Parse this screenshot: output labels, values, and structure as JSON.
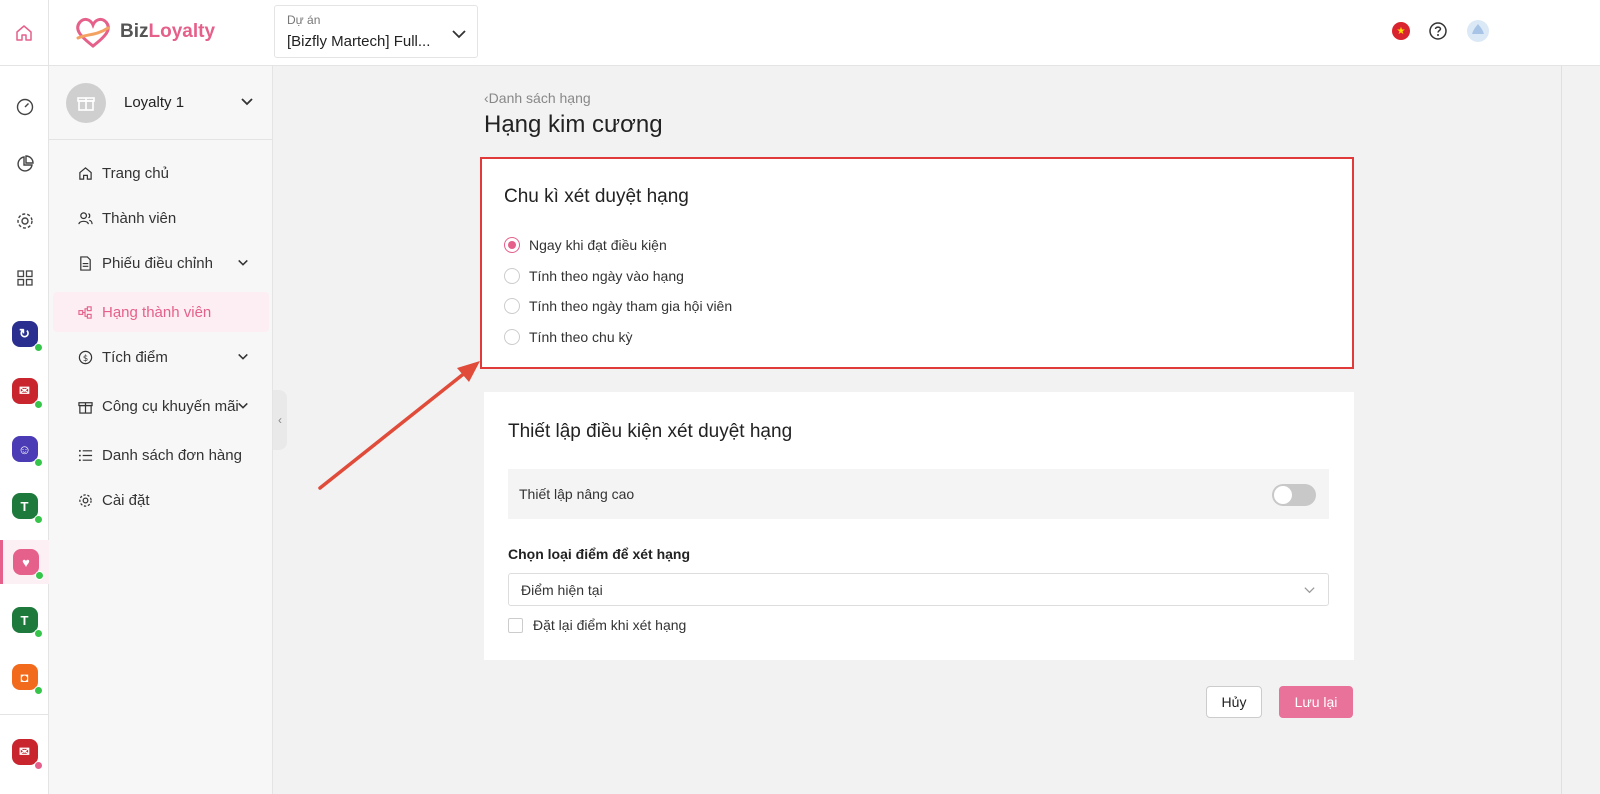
{
  "topbar": {
    "logo": {
      "part1": "Biz",
      "part2": "Loyalty"
    },
    "project": {
      "label": "Dự án",
      "value": "[Bizfly Martech] Full..."
    }
  },
  "colors": {
    "accent": "#e5608a",
    "highlight_border": "#e03a3a",
    "save_button": "#e9729a"
  },
  "sidebar": {
    "program": "Loyalty 1",
    "items": [
      {
        "label": "Trang chủ",
        "icon": "home-icon"
      },
      {
        "label": "Thành viên",
        "icon": "members-icon"
      },
      {
        "label": "Phiếu điều chỉnh",
        "icon": "document-icon"
      },
      {
        "label": "Hạng thành viên",
        "icon": "tier-icon"
      },
      {
        "label": "Tích điểm",
        "icon": "dollar-icon"
      },
      {
        "label": "Công cụ khuyến mãi",
        "icon": "gift-icon"
      },
      {
        "label": "Danh sách đơn hàng",
        "icon": "list-icon"
      },
      {
        "label": "Cài đặt",
        "icon": "gear-icon"
      }
    ]
  },
  "main": {
    "breadcrumb": "Danh sách hạng",
    "title": "Hạng kim cương",
    "cycle": {
      "title": "Chu kì xét duyệt hạng",
      "options": [
        "Ngay khi đạt điều kiện",
        "Tính theo ngày vào hạng",
        "Tính theo ngày tham gia hội viên",
        "Tính theo chu kỳ"
      ],
      "selected": 0
    },
    "conditions": {
      "title": "Thiết lập điều kiện xét duyệt hạng",
      "advanced_label": "Thiết lập nâng cao",
      "advanced_enabled": false,
      "points_label": "Chọn loại điểm để xét hạng",
      "points_value": "Điểm hiện tại",
      "reset_label": "Đặt lại điểm khi xét hạng",
      "reset_checked": false
    },
    "buttons": {
      "cancel": "Hủy",
      "save": "Lưu lại"
    }
  }
}
